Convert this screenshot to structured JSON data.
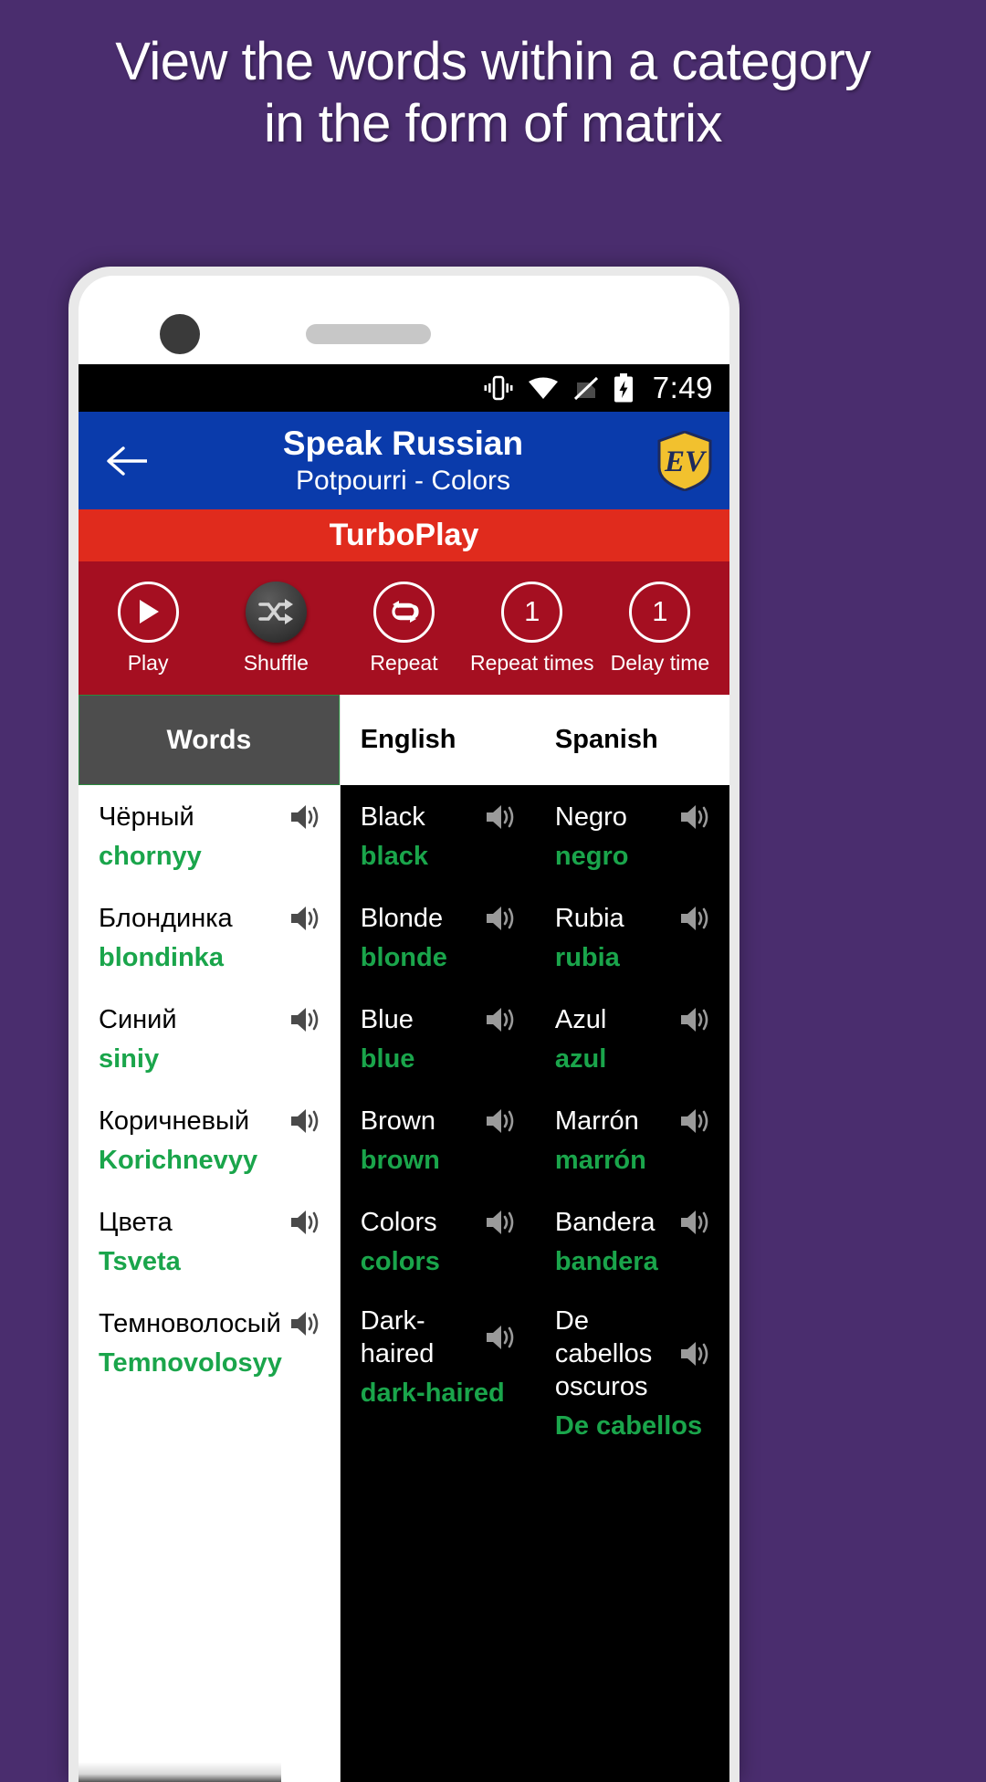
{
  "promo": {
    "heading": "View the words within a category in the form of matrix"
  },
  "colors": {
    "page_bg": "#4a2d6e",
    "appbar": "#0a3bab",
    "turbo": "#e02b1d",
    "controls": "#a50f21",
    "header_words": "#4d4d4d",
    "transliteration": "#1aa54b"
  },
  "statusbar": {
    "time": "7:49",
    "icons": [
      "vibrate-icon",
      "wifi-icon",
      "sim-off-icon",
      "battery-charging-icon"
    ]
  },
  "appbar": {
    "back_icon": "back-arrow-icon",
    "title": "Speak Russian",
    "subtitle": "Potpourri - Colors",
    "logo_text": "EV"
  },
  "turboplay": {
    "label": "TurboPlay"
  },
  "controls": [
    {
      "label": "Play",
      "icon": "play-icon",
      "value": "",
      "style": "outline"
    },
    {
      "label": "Shuffle",
      "icon": "shuffle-icon",
      "value": "",
      "style": "filled"
    },
    {
      "label": "Repeat",
      "icon": "repeat-icon",
      "value": "",
      "style": "outline"
    },
    {
      "label": "Repeat times",
      "icon": "number",
      "value": "1",
      "style": "outline"
    },
    {
      "label": "Delay time",
      "icon": "number",
      "value": "1",
      "style": "outline"
    }
  ],
  "matrix": {
    "headers": [
      "Words",
      "English",
      "Spanish"
    ],
    "rows": [
      {
        "words": {
          "main": "Чёрный",
          "trans": "chornyy"
        },
        "english": {
          "main": "Black",
          "trans": "black"
        },
        "spanish": {
          "main": "Negro",
          "trans": "negro"
        }
      },
      {
        "words": {
          "main": "Блондинка",
          "trans": "blondinka"
        },
        "english": {
          "main": "Blonde",
          "trans": "blonde"
        },
        "spanish": {
          "main": "Rubia",
          "trans": "rubia"
        }
      },
      {
        "words": {
          "main": "Синий",
          "trans": "siniy"
        },
        "english": {
          "main": "Blue",
          "trans": "blue"
        },
        "spanish": {
          "main": "Azul",
          "trans": "azul"
        }
      },
      {
        "words": {
          "main": "Коричневый",
          "trans": "Korichnevyy"
        },
        "english": {
          "main": "Brown",
          "trans": "brown"
        },
        "spanish": {
          "main": "Marrón",
          "trans": "marrón"
        }
      },
      {
        "words": {
          "main": "Цвета",
          "trans": "Tsveta"
        },
        "english": {
          "main": "Colors",
          "trans": "colors"
        },
        "spanish": {
          "main": "Bandera",
          "trans": "bandera"
        }
      },
      {
        "words": {
          "main": "Темноволосый",
          "trans": "Temnovolosyy"
        },
        "english": {
          "main": "Dark-haired",
          "trans": "dark-haired"
        },
        "spanish": {
          "main": "De cabellos oscuros",
          "trans": "De cabellos"
        }
      }
    ]
  }
}
